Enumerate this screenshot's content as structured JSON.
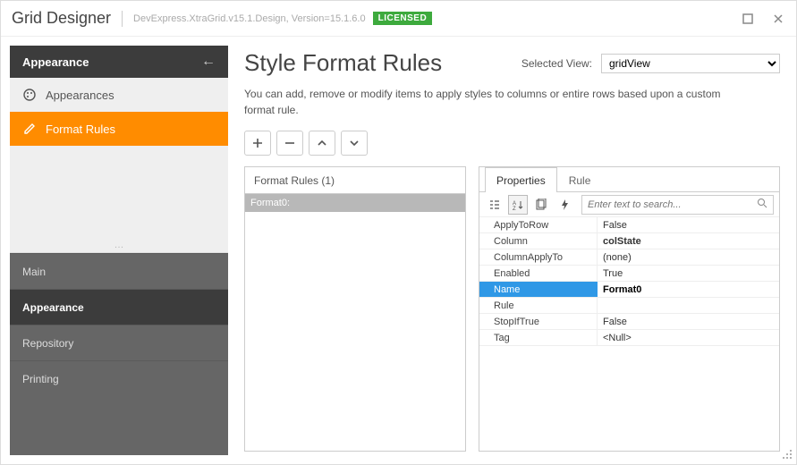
{
  "titlebar": {
    "title": "Grid Designer",
    "version": "DevExpress.XtraGrid.v15.1.Design, Version=15.1.6.0",
    "license": "LICENSED"
  },
  "sidebar": {
    "section": "Appearance",
    "items": [
      {
        "label": "Appearances"
      },
      {
        "label": "Format Rules"
      }
    ],
    "categories": [
      {
        "label": "Main"
      },
      {
        "label": "Appearance"
      },
      {
        "label": "Repository"
      },
      {
        "label": "Printing"
      }
    ]
  },
  "page": {
    "title": "Style Format Rules",
    "selected_view_label": "Selected View:",
    "selected_view_value": "gridView",
    "description": "You can add, remove or modify items to apply styles to columns or entire rows based upon a custom format rule."
  },
  "list": {
    "header": "Format Rules (1)",
    "items": [
      {
        "label": "Format0:"
      }
    ]
  },
  "tabs": {
    "properties": "Properties",
    "rule": "Rule"
  },
  "search_placeholder": "Enter text to search...",
  "props": [
    {
      "k": "ApplyToRow",
      "v": "False"
    },
    {
      "k": "Column",
      "v": "colState",
      "bold": true
    },
    {
      "k": "ColumnApplyTo",
      "v": "(none)"
    },
    {
      "k": "Enabled",
      "v": "True"
    },
    {
      "k": "Name",
      "v": "Format0",
      "bold": true,
      "selected": true
    },
    {
      "k": "Rule",
      "v": ""
    },
    {
      "k": "StopIfTrue",
      "v": "False"
    },
    {
      "k": "Tag",
      "v": "<Null>"
    }
  ]
}
